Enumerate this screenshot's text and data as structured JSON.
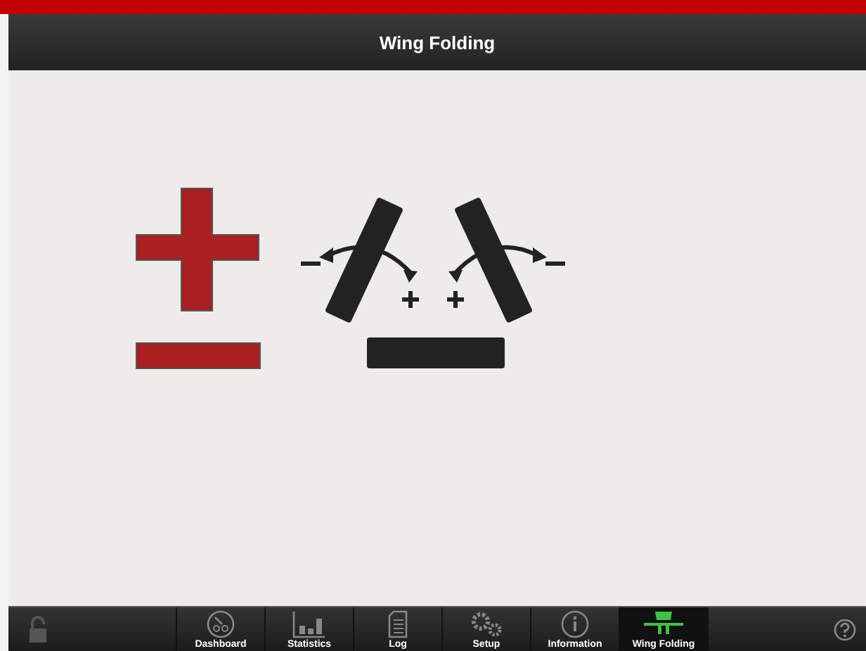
{
  "window": {
    "title": "Wing Folding"
  },
  "tabs": [
    {
      "label": "Dashboard",
      "kind": "gauge",
      "selected": false
    },
    {
      "label": "Statistics",
      "kind": "bars",
      "selected": false
    },
    {
      "label": "Log",
      "kind": "doc",
      "selected": false
    },
    {
      "label": "Setup",
      "kind": "gears",
      "selected": false
    },
    {
      "label": "Information",
      "kind": "info",
      "selected": false
    },
    {
      "label": "Wing Folding",
      "kind": "wing",
      "selected": true
    }
  ]
}
